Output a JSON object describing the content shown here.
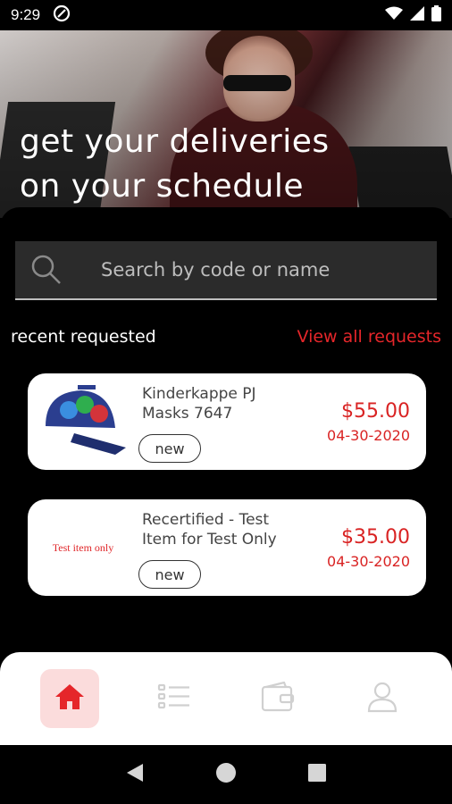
{
  "status_bar": {
    "time": "9:29",
    "icons": [
      "at-sign-icon",
      "wifi-icon",
      "signal-icon",
      "battery-icon"
    ]
  },
  "hero": {
    "title_line1": "get your deliveries",
    "title_line2": "on your schedule"
  },
  "search": {
    "placeholder": "Search by code or name",
    "icon": "search-icon"
  },
  "recent": {
    "title": "recent requested",
    "view_all": "View all requests",
    "items": [
      {
        "name": "Kinderkappe PJ Masks 7647",
        "badge": "new",
        "price": "$55.00",
        "date": "04-30-2020",
        "thumb_text": ""
      },
      {
        "name": "Recertified - Test Item for Test Only",
        "badge": "new",
        "price": "$35.00",
        "date": "04-30-2020",
        "thumb_text": "Test item only"
      }
    ]
  },
  "bottom_nav": {
    "items": [
      "home-icon",
      "list-icon",
      "wallet-icon",
      "user-icon"
    ],
    "active": "home-icon",
    "accent": "#e5262a"
  },
  "system_nav": [
    "back-icon",
    "home-circle-icon",
    "recents-icon"
  ]
}
